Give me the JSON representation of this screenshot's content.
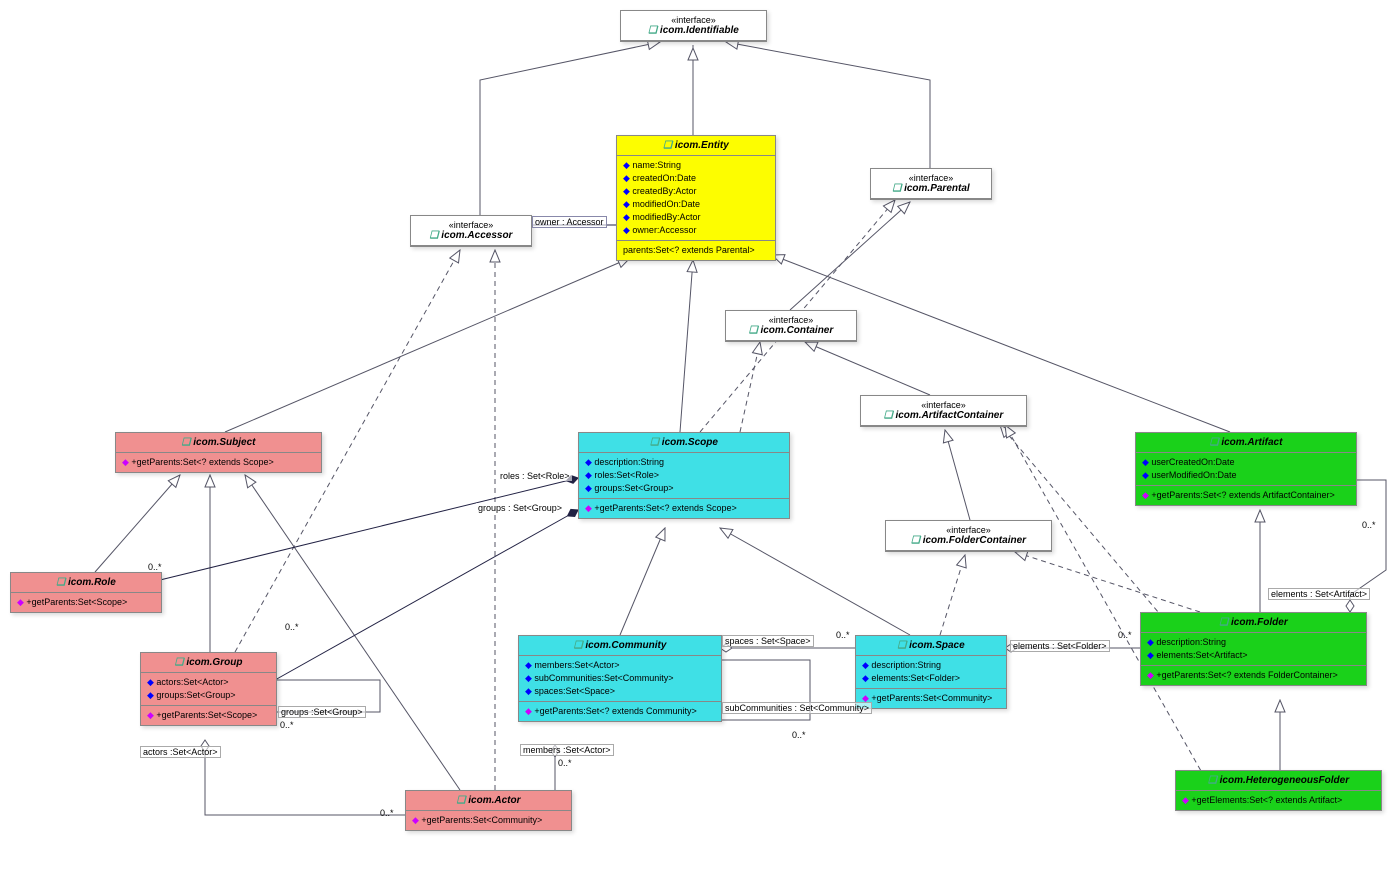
{
  "chart_data": {
    "type": "uml_class_diagram",
    "classes": [
      {
        "id": "identifiable",
        "stereotype": "«interface»",
        "name": "icom.Identifiable"
      },
      {
        "id": "accessor",
        "stereotype": "«interface»",
        "name": "icom.Accessor"
      },
      {
        "id": "parental",
        "stereotype": "«interface»",
        "name": "icom.Parental"
      },
      {
        "id": "container",
        "stereotype": "«interface»",
        "name": "icom.Container"
      },
      {
        "id": "artifactContainer",
        "stereotype": "«interface»",
        "name": "icom.ArtifactContainer"
      },
      {
        "id": "folderContainer",
        "stereotype": "«interface»",
        "name": "icom.FolderContainer"
      },
      {
        "id": "entity",
        "name": "icom.Entity",
        "attrs": [
          "name:String",
          "createdOn:Date",
          "createdBy:Actor",
          "modifiedOn:Date",
          "modifiedBy:Actor",
          "owner:Accessor"
        ],
        "footer": "parents:Set<? extends Parental>"
      },
      {
        "id": "subject",
        "name": "icom.Subject",
        "ops": [
          "+getParents:Set<? extends Scope>"
        ]
      },
      {
        "id": "role",
        "name": "icom.Role",
        "ops": [
          "+getParents:Set<Scope>"
        ]
      },
      {
        "id": "group",
        "name": "icom.Group",
        "attrs": [
          "actors:Set<Actor>",
          "groups:Set<Group>"
        ],
        "ops": [
          "+getParents:Set<Scope>"
        ]
      },
      {
        "id": "actor",
        "name": "icom.Actor",
        "ops": [
          "+getParents:Set<Community>"
        ]
      },
      {
        "id": "scope",
        "name": "icom.Scope",
        "attrs": [
          "description:String",
          "roles:Set<Role>",
          "groups:Set<Group>"
        ],
        "ops": [
          "+getParents:Set<? extends Scope>"
        ]
      },
      {
        "id": "community",
        "name": "icom.Community",
        "attrs": [
          "members:Set<Actor>",
          "subCommunities:Set<Community>",
          "spaces:Set<Space>"
        ],
        "ops": [
          "+getParents:Set<? extends Community>"
        ]
      },
      {
        "id": "space",
        "name": "icom.Space",
        "attrs": [
          "description:String",
          "elements:Set<Folder>"
        ],
        "ops": [
          "+getParents:Set<Community>"
        ]
      },
      {
        "id": "artifact",
        "name": "icom.Artifact",
        "attrs": [
          "userCreatedOn:Date",
          "userModifiedOn:Date"
        ],
        "ops": [
          "+getParents:Set<? extends ArtifactContainer>"
        ]
      },
      {
        "id": "folder",
        "name": "icom.Folder",
        "attrs": [
          "description:String",
          "elements:Set<Artifact>"
        ],
        "ops": [
          "+getParents:Set<? extends FolderContainer>"
        ]
      },
      {
        "id": "hetFolder",
        "name": "icom.HeterogeneousFolder",
        "ops": [
          "+getElements:Set<? extends Artifact>"
        ]
      }
    ],
    "relations": [
      {
        "from": "entity",
        "to": "identifiable",
        "type": "generalization"
      },
      {
        "from": "accessor",
        "to": "identifiable",
        "type": "generalization"
      },
      {
        "from": "parental",
        "to": "identifiable",
        "type": "generalization"
      },
      {
        "from": "container",
        "to": "parental",
        "type": "generalization"
      },
      {
        "from": "artifactContainer",
        "to": "container",
        "type": "generalization"
      },
      {
        "from": "folderContainer",
        "to": "artifactContainer",
        "type": "generalization"
      },
      {
        "from": "subject",
        "to": "entity",
        "type": "generalization"
      },
      {
        "from": "scope",
        "to": "entity",
        "type": "generalization"
      },
      {
        "from": "artifact",
        "to": "entity",
        "type": "generalization"
      },
      {
        "from": "role",
        "to": "subject",
        "type": "generalization"
      },
      {
        "from": "group",
        "to": "subject",
        "type": "generalization"
      },
      {
        "from": "actor",
        "to": "subject",
        "type": "generalization"
      },
      {
        "from": "community",
        "to": "scope",
        "type": "generalization"
      },
      {
        "from": "space",
        "to": "scope",
        "type": "generalization"
      },
      {
        "from": "folder",
        "to": "artifact",
        "type": "generalization"
      },
      {
        "from": "hetFolder",
        "to": "folder",
        "type": "generalization"
      },
      {
        "from": "scope",
        "to": "parental",
        "type": "realization"
      },
      {
        "from": "scope",
        "to": "container",
        "type": "realization"
      },
      {
        "from": "group",
        "to": "accessor",
        "type": "realization"
      },
      {
        "from": "actor",
        "to": "accessor",
        "type": "realization"
      },
      {
        "from": "space",
        "to": "folderContainer",
        "type": "realization"
      },
      {
        "from": "folder",
        "to": "folderContainer",
        "type": "realization"
      },
      {
        "from": "folder",
        "to": "artifactContainer",
        "type": "realization"
      },
      {
        "from": "hetFolder",
        "to": "artifactContainer",
        "type": "realization"
      },
      {
        "from": "entity",
        "to": "accessor",
        "type": "association",
        "label": "owner : Accessor"
      },
      {
        "from": "scope",
        "to": "role",
        "type": "composition",
        "label": "roles : Set<Role>",
        "mult": "0..*"
      },
      {
        "from": "scope",
        "to": "group",
        "type": "composition",
        "label": "groups : Set<Group>",
        "mult": "0..*"
      },
      {
        "from": "group",
        "to": "group",
        "type": "aggregation",
        "label": "groups :Set<Group>",
        "mult": "0..*"
      },
      {
        "from": "group",
        "to": "actor",
        "type": "aggregation",
        "label": "actors :Set<Actor>",
        "mult": "0..*"
      },
      {
        "from": "community",
        "to": "actor",
        "type": "aggregation",
        "label": "members :Set<Actor>",
        "mult": "0..*"
      },
      {
        "from": "community",
        "to": "community",
        "type": "aggregation",
        "label": "subCommunities : Set<Community>",
        "mult": "0..*"
      },
      {
        "from": "community",
        "to": "space",
        "type": "aggregation",
        "label": "spaces : Set<Space>",
        "mult": "0..*"
      },
      {
        "from": "space",
        "to": "folder",
        "type": "aggregation",
        "label": "elements : Set<Folder>",
        "mult": "0..*"
      },
      {
        "from": "folder",
        "to": "artifact",
        "type": "aggregation",
        "label": "elements : Set<Artifact>",
        "mult": "0..*"
      }
    ]
  },
  "boxes": {
    "identifiable": {
      "stereo": "«interface»",
      "title": "icom.Identifiable"
    },
    "accessor": {
      "stereo": "«interface»",
      "title": "icom.Accessor"
    },
    "parental": {
      "stereo": "«interface»",
      "title": "icom.Parental"
    },
    "container": {
      "stereo": "«interface»",
      "title": "icom.Container"
    },
    "artifactContainer": {
      "stereo": "«interface»",
      "title": "icom.ArtifactContainer"
    },
    "folderContainer": {
      "stereo": "«interface»",
      "title": "icom.FolderContainer"
    },
    "entity": {
      "title": "icom.Entity",
      "a0": "name:String",
      "a1": "createdOn:Date",
      "a2": "createdBy:Actor",
      "a3": "modifiedOn:Date",
      "a4": "modifiedBy:Actor",
      "a5": "owner:Accessor",
      "foot": "parents:Set<? extends Parental>"
    },
    "subject": {
      "title": "icom.Subject",
      "op0": "+getParents:Set<? extends Scope>"
    },
    "role": {
      "title": "icom.Role",
      "op0": "+getParents:Set<Scope>"
    },
    "group": {
      "title": "icom.Group",
      "a0": "actors:Set<Actor>",
      "a1": "groups:Set<Group>",
      "op0": "+getParents:Set<Scope>"
    },
    "actor": {
      "title": "icom.Actor",
      "op0": "+getParents:Set<Community>"
    },
    "scope": {
      "title": "icom.Scope",
      "a0": "description:String",
      "a1": "roles:Set<Role>",
      "a2": "groups:Set<Group>",
      "op0": "+getParents:Set<? extends Scope>"
    },
    "community": {
      "title": "icom.Community",
      "a0": "members:Set<Actor>",
      "a1": "subCommunities:Set<Community>",
      "a2": "spaces:Set<Space>",
      "op0": "+getParents:Set<? extends Community>"
    },
    "space": {
      "title": "icom.Space",
      "a0": "description:String",
      "a1": "elements:Set<Folder>",
      "op0": "+getParents:Set<Community>"
    },
    "artifact": {
      "title": "icom.Artifact",
      "a0": "userCreatedOn:Date",
      "a1": "userModifiedOn:Date",
      "op0": "+getParents:Set<? extends ArtifactContainer>"
    },
    "folder": {
      "title": "icom.Folder",
      "a0": "description:String",
      "a1": "elements:Set<Artifact>",
      "op0": "+getParents:Set<? extends FolderContainer>"
    },
    "hetFolder": {
      "title": "icom.HeterogeneousFolder",
      "op0": "+getElements:Set<? extends Artifact>"
    }
  },
  "labels": {
    "owner": "owner : Accessor",
    "roles": "roles : Set<Role>",
    "groupsScope": "groups : Set<Group>",
    "groupsSelf": "groups :Set<Group>",
    "actors": "actors :Set<Actor>",
    "members": "members :Set<Actor>",
    "subComm": "subCommunities : Set<Community>",
    "spaces": "spaces : Set<Space>",
    "elementsFolder": "elements : Set<Folder>",
    "elementsArtifact": "elements : Set<Artifact>",
    "m0": "0..*"
  }
}
